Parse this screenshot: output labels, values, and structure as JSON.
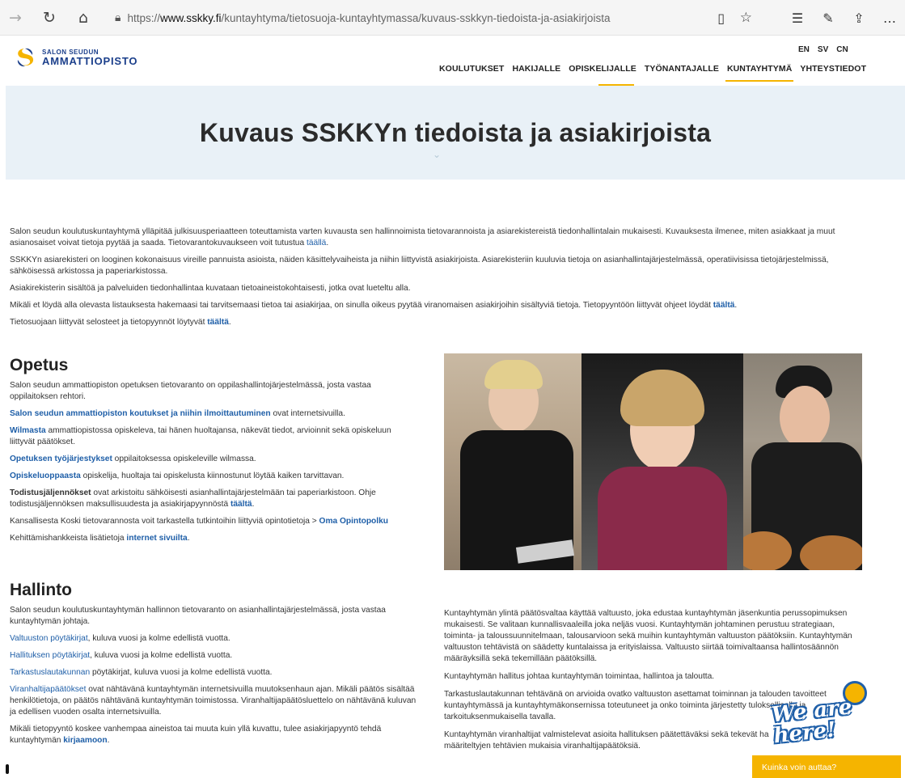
{
  "browser": {
    "url_prefix": "https://",
    "url_host": "www.sskky.fi",
    "url_path": "/kuntayhtyma/tietosuoja-kuntayhtymassa/kuvaus-sskkyn-tiedoista-ja-asiakirjoista",
    "icons": [
      "back-icon",
      "refresh-icon",
      "home-icon",
      "lock-icon",
      "reader-icon",
      "favorite-icon",
      "favorites-list-icon",
      "pen-icon",
      "share-icon",
      "more-icon"
    ]
  },
  "site": {
    "logo_line1": "SALON SEUDUN",
    "logo_line2": "AMMATTIOPISTO",
    "languages": [
      "EN",
      "SV",
      "CN"
    ],
    "nav": [
      "KOULUTUKSET",
      "HAKIJALLE",
      "OPISKELIJALLE",
      "TYÖNANTAJALLE",
      "KUNTAYHTYMÄ",
      "YHTEYSTIEDOT"
    ],
    "active_nav": "KUNTAYHTYMÄ",
    "accent_color": "#f5b400",
    "brand_color": "#1b3f8b"
  },
  "hero": {
    "title": "Kuvaus SSKKYn tiedoista ja asiakirjoista"
  },
  "intro": {
    "p1_text": "Salon seudun koulutuskuntayhtymä ylläpitää julkisuusperiaatteen toteuttamista varten kuvausta sen hallinnoimista tietovarannoista ja asiarekistereistä tiedonhallintalain mukaisesti. Kuvauksesta ilmenee, miten asiakkaat ja muut asianosaiset voivat tietoja pyytää ja saada. Tietovarantokuvaukseen voit tutustua ",
    "p1_link": "täällä",
    "p2": "SSKKYn asiarekisteri on looginen kokonaisuus vireille pannuista asioista, näiden käsittelyvaiheista ja niihin liittyvistä asiakirjoista. Asiarekisteriin kuuluvia tietoja on asianhallintajärjestelmässä, operatiivisissa tietojärjestelmissä, sähköisessä arkistossa ja paperiarkistossa.",
    "p3": "Asiakirekisterin sisältöä ja palveluiden tiedonhallintaa kuvataan tietoaineistokohtaisesti, jotka ovat lueteltu alla.",
    "p4_text": "Mikäli et löydä alla olevasta listauksesta hakemaasi tai tarvitsemaasi tietoa tai asiakirjaa, on sinulla oikeus pyytää viranomaisen asiakirjoihin sisältyviä tietoja. Tietopyyntöön liittyvät ohjeet löydät ",
    "p4_link": "täältä",
    "p5_text": "Tietosuojaan liittyvät selosteet ja tietopyynnöt löytyvät ",
    "p5_link": "täältä"
  },
  "opetus": {
    "heading": "Opetus",
    "p1": "Salon seudun ammattiopiston opetuksen tietovaranto on oppilashallintojärjestelmässä, josta vastaa oppilaitoksen rehtori.",
    "p2_link": "Salon seudun ammattiopiston koutukset ja niihin ilmoittautuminen",
    "p2_text": " ovat internetsivuilla.",
    "p3_link": "Wilmasta",
    "p3_text": " ammattiopistossa opiskeleva, tai hänen huoltajansa, näkevät tiedot, arvioinnit sekä opiskeluun liittyvät päätökset.",
    "p4_link": "Opetuksen työjärjestykset",
    "p4_text": " oppilaitoksessa opiskeleville wilmassa.",
    "p5_link": "Opiskeluoppaasta",
    "p5_text": " opiskelija, huoltaja tai opiskelusta kiinnostunut löytää kaiken tarvittavan.",
    "p6_bold": "Todistusjäljennökset",
    "p6_text": " ovat arkistoitu sähköisesti asianhallintajärjestelmään tai paperiarkistoon. Ohje todistusjäljennöksen maksullisuudesta ja asiakirjapyynnöstä ",
    "p6_link": "täältä",
    "p7_text": "Kansallisesta Koski tietovarannosta voit tarkastella tutkintoihin liittyviä opintotietoja > ",
    "p7_link": "Oma Opintopolku",
    "p8_text": "Kehittämishankkeista lisätietoja ",
    "p8_link": "internet sivuilta"
  },
  "hallinto": {
    "heading": "Hallinto",
    "p1": "Salon seudun koulutuskuntayhtymän hallinnon tietovaranto on asianhallintajärjestelmässä, josta vastaa kuntayhtymän johtaja.",
    "p2_link": "Valtuuston pöytäkirjat",
    "p2_text": ", kuluva vuosi ja kolme edellistä vuotta.",
    "p3_link": "Hallituksen pöytäkirjat",
    "p3_text": ", kuluva vuosi ja kolme edellistä vuotta.",
    "p4_link": "Tarkastuslautakunnan",
    "p4_text": " pöytäkirjat, kuluva vuosi ja kolme edellistä vuotta.",
    "p5_link": "Viranhaltijapäätökset",
    "p5_text": " ovat nähtävänä kuntayhtymän internetsivuilla muutoksenhaun ajan. Mikäli päätös sisältää henkilötietoja, on päätös nähtävänä kuntayhtymän toimistossa. Viranhaltijapäätösluettelo on nähtävänä kuluvan ja edellisen vuoden osalta internetsivuilla.",
    "p6_text": "Mikäli tietopyyntö koskee vanhempaa aineistoa tai muuta kuin yllä kuvattu, tulee asiakirjapyyntö tehdä kuntayhtymän ",
    "p6_link": "kirjaamoon"
  },
  "right_col": {
    "p1": "Kuntayhtymän ylintä päätösvaltaa käyttää valtuusto, joka edustaa kuntayhtymän jäsenkuntia perussopimuksen mukaisesti. Se valitaan kunnallisvaaleilla joka neljäs vuosi. Kuntayhtymän johtaminen perustuu strategiaan, toiminta- ja taloussuunnitelmaan, talousarvioon sekä muihin kuntayhtymän valtuuston päätöksiin. Kuntayhtymän valtuuston tehtävistä on säädetty kuntalaissa ja erityislaissa. Valtuusto siirtää toimivaltaansa hallintosäännön määräyksillä sekä tekemillään päätöksillä.",
    "p2": "Kuntayhtymän hallitus johtaa kuntayhtymän toimintaa, hallintoa ja taloutta.",
    "p3": "Tarkastuslautakunnan tehtävänä on arvioida ovatko valtuuston asettamat toiminnan ja talouden tavoitteet kuntayhtymässä ja kuntayhtymäkonsernissa toteutuneet ja onko toiminta järjestetty tuloksellisella ja tarkoituksenmukaisella tavalla.",
    "p4": "Kuntayhtymän viranhaltijat valmistelevat asioita hallituksen päätettäväksi sekä tekevät ha",
    "p4b": "määriteltyjen tehtävien mukaisia viranhaltijapäätöksiä."
  },
  "chat": {
    "mascot_text": "We are here!",
    "button_label": "Kuinka voin auttaa?"
  }
}
